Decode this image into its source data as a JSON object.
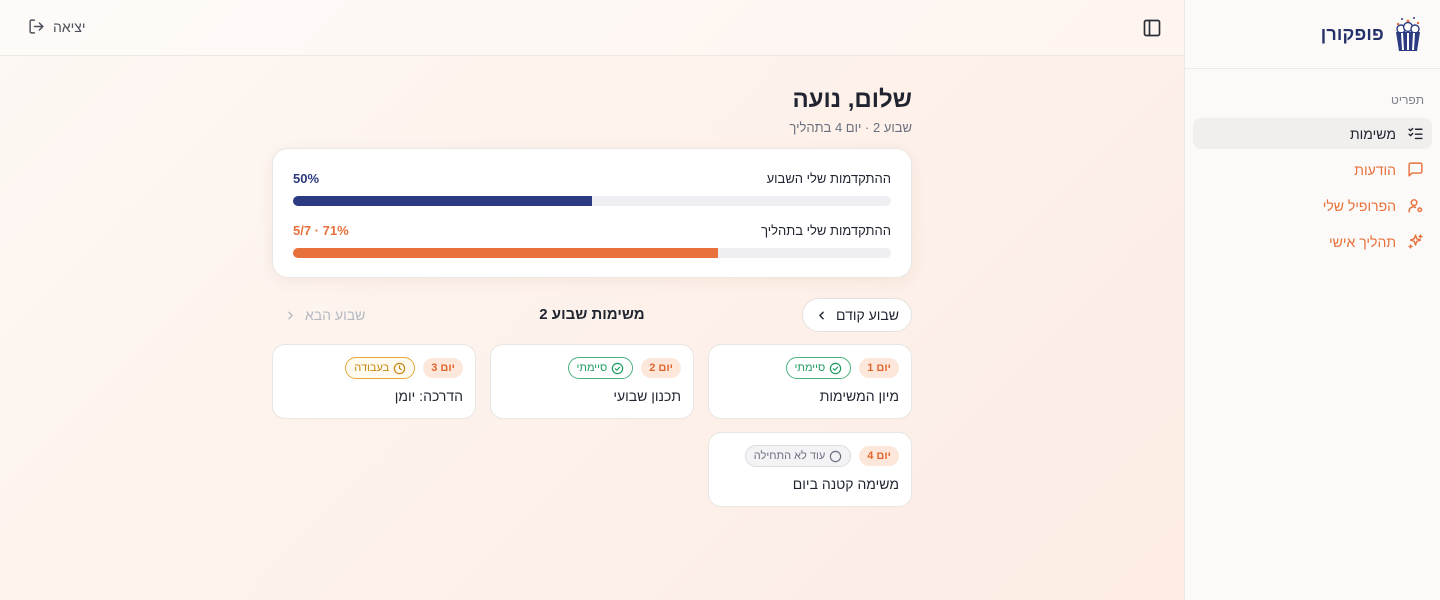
{
  "app": {
    "brand": "פופקורן"
  },
  "sidebar": {
    "section_label": "תפריט",
    "items": [
      {
        "label": "משימות",
        "icon": "list-checks-icon",
        "active": true
      },
      {
        "label": "הודעות",
        "icon": "message-square-icon",
        "active": false
      },
      {
        "label": "הפרופיל שלי",
        "icon": "user-cog-icon",
        "active": false
      },
      {
        "label": "תהליך אישי",
        "icon": "sparkles-icon",
        "active": false
      }
    ]
  },
  "header": {
    "logout_label": "יציאה"
  },
  "main": {
    "greeting": "שלום, נועה",
    "subtitle": "שבוע 2 · יום 4 בתהליך",
    "progress": {
      "week": {
        "label": "ההתקדמות שלי השבוע",
        "value_text": "50%",
        "fraction": 0.5
      },
      "overall": {
        "label": "ההתקדמות שלי בתהליך",
        "value_text": "5/7 · 71%",
        "fraction": 0.71
      }
    },
    "week_nav": {
      "prev_label": "שבוע קודם",
      "title": "משימות שבוע 2",
      "next_label": "שבוע הבא"
    },
    "tasks": [
      {
        "day": "יום 1",
        "status": "סיימתי",
        "status_type": "done",
        "title": "מיון המשימות"
      },
      {
        "day": "יום 2",
        "status": "סיימתי",
        "status_type": "done",
        "title": "תכנון שבועי"
      },
      {
        "day": "יום 3",
        "status": "בעבודה",
        "status_type": "progress",
        "title": "הדרכה: יומן"
      },
      {
        "day": "יום 4",
        "status": "עוד לא התחילה",
        "status_type": "new",
        "title": "משימה קטנה ביום"
      }
    ]
  }
}
